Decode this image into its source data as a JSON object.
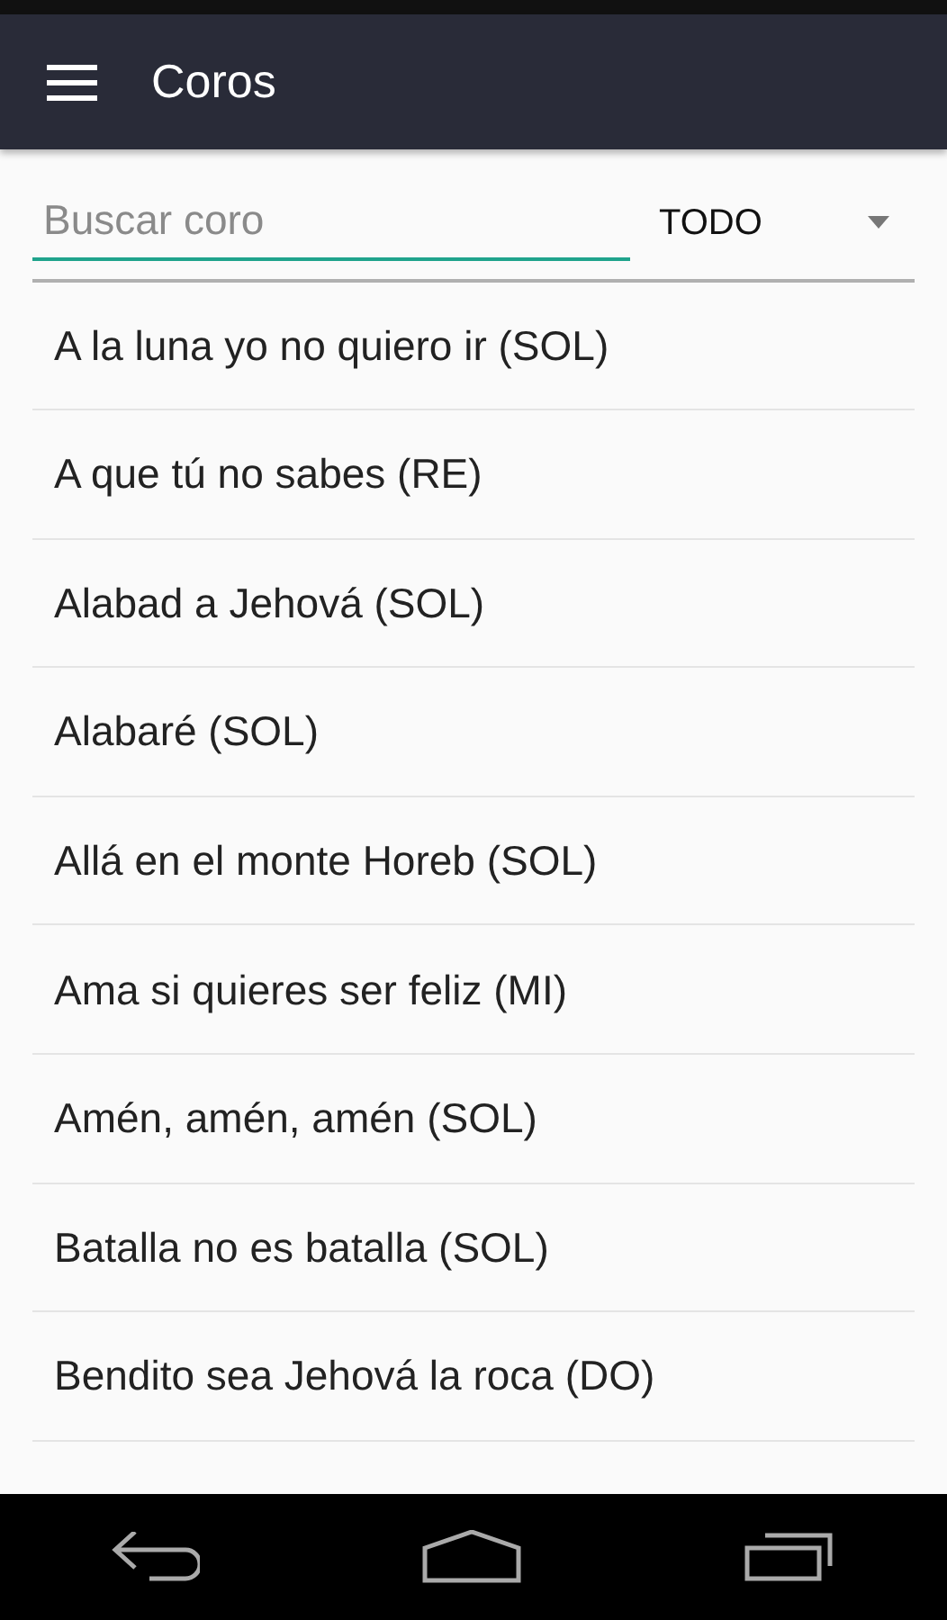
{
  "toolbar": {
    "title": "Coros"
  },
  "search": {
    "placeholder": "Buscar coro"
  },
  "filter": {
    "value": "TODO"
  },
  "songs": [
    {
      "title": "A la luna yo no quiero ir (SOL)"
    },
    {
      "title": "A que tú no sabes (RE)"
    },
    {
      "title": "Alabad a Jehová (SOL)"
    },
    {
      "title": "Alabaré (SOL)"
    },
    {
      "title": "Allá en el monte Horeb (SOL)"
    },
    {
      "title": "Ama si quieres ser feliz (MI)"
    },
    {
      "title": "Amén, amén, amén (SOL)"
    },
    {
      "title": "Batalla no es batalla (SOL)"
    },
    {
      "title": "Bendito sea Jehová la roca (DO)"
    }
  ]
}
